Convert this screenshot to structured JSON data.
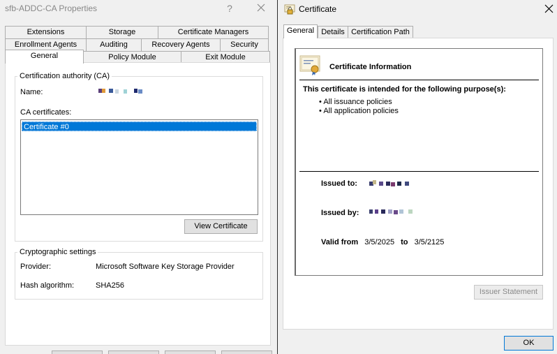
{
  "properties_window": {
    "title": "sfb-ADDC-CA Properties",
    "help_glyph": "?",
    "tabs_row1": [
      "Extensions",
      "Storage",
      "Certificate Managers"
    ],
    "tabs_row2": [
      "Enrollment Agents",
      "Auditing",
      "Recovery Agents",
      "Security"
    ],
    "tabs_row3": [
      "General",
      "Policy Module",
      "Exit Module"
    ],
    "selected_tab": "General",
    "ca_group": {
      "title": "Certification authority (CA)",
      "name_label": "Name:",
      "ca_certificates_label": "CA certificates:",
      "certificates": [
        "Certificate #0"
      ],
      "view_certificate_button": "View Certificate"
    },
    "crypto_group": {
      "title": "Cryptographic settings",
      "provider_label": "Provider:",
      "provider_value": "Microsoft Software Key Storage Provider",
      "hash_label": "Hash algorithm:",
      "hash_value": "SHA256"
    }
  },
  "certificate_window": {
    "title": "Certificate",
    "tabs": [
      "General",
      "Details",
      "Certification Path"
    ],
    "selected_tab": "General",
    "info_heading": "Certificate Information",
    "purpose_heading": "This certificate is intended for the following purpose(s):",
    "purposes": [
      "All issuance policies",
      "All application policies"
    ],
    "issued_to_label": "Issued to:",
    "issued_by_label": "Issued by:",
    "valid_from_label": "Valid from",
    "valid_from": "3/5/2025",
    "to_label": "to",
    "valid_to": "3/5/2125",
    "issuer_statement_button": "Issuer Statement",
    "ok_button": "OK"
  },
  "icons": {
    "certificate_window_icon": "certificate-lock-icon",
    "certificate_info_icon": "certificate-ribbon-icon"
  },
  "colors": {
    "selection": "#0078d7",
    "focus_border": "#0078d7"
  }
}
